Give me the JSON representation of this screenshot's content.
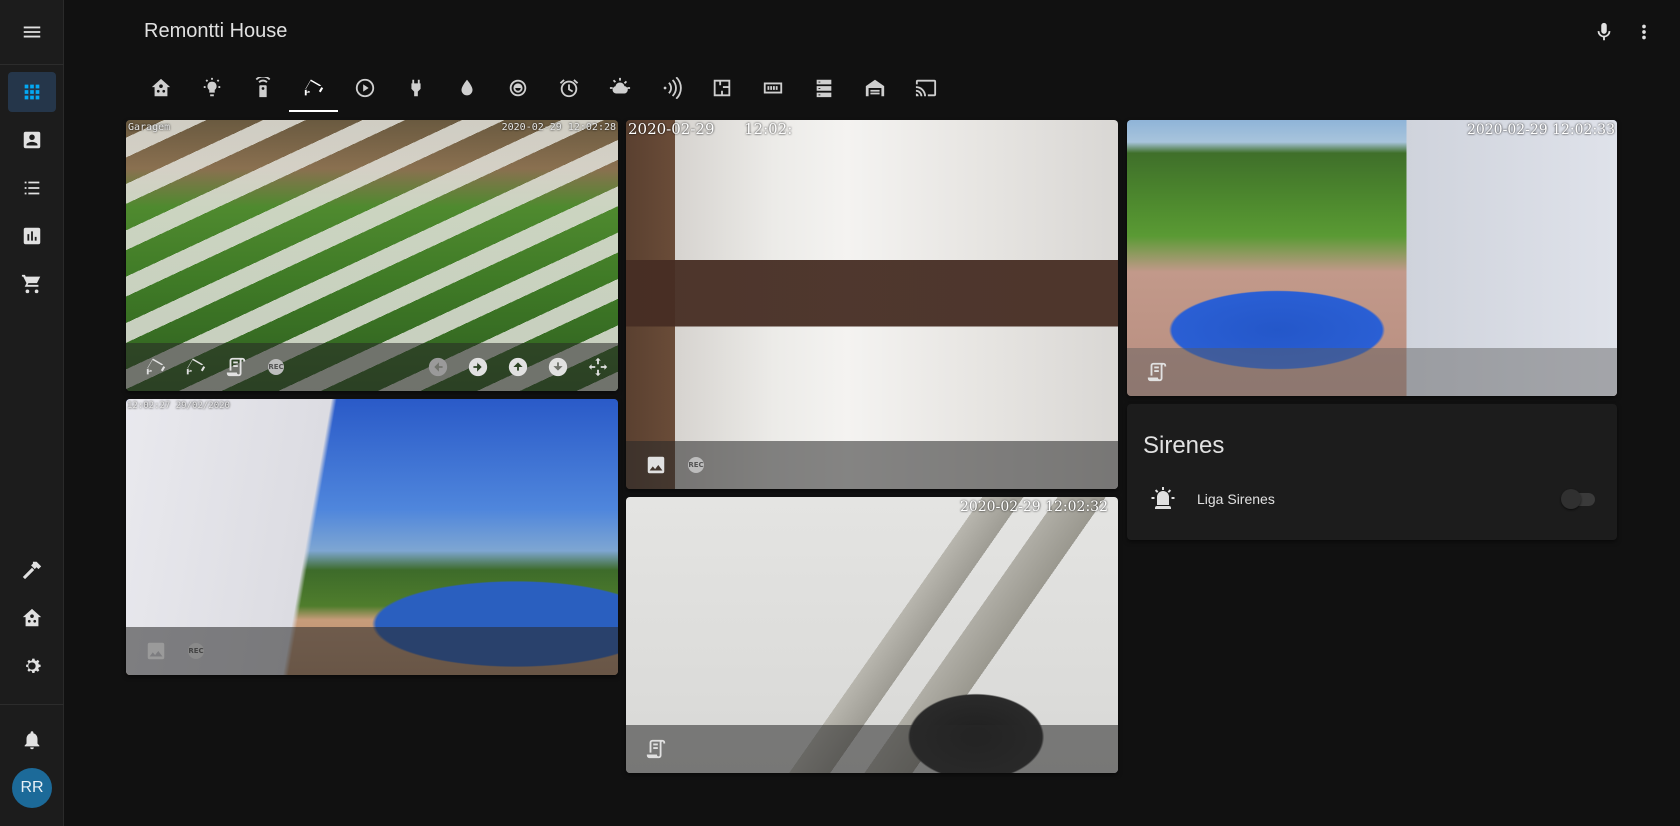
{
  "app": {
    "title": "Remontti House",
    "user_initials": "RR"
  },
  "header": {
    "menu_icon": "menu-icon",
    "mic_icon": "microphone-icon",
    "more_icon": "dots-vertical-icon"
  },
  "sidebar": {
    "items": [
      {
        "icon": "view-dashboard-icon",
        "active": true
      },
      {
        "icon": "account-box-icon",
        "active": false
      },
      {
        "icon": "format-list-bulleted-icon",
        "active": false
      },
      {
        "icon": "chart-box-icon",
        "active": false
      },
      {
        "icon": "cart-icon",
        "active": false
      }
    ],
    "bottom_items": [
      {
        "icon": "hammer-icon"
      },
      {
        "icon": "home-assistant-icon"
      },
      {
        "icon": "cog-icon"
      },
      {
        "icon": "bell-icon"
      }
    ],
    "active_color": "#03a9f4"
  },
  "tabs": [
    {
      "icon": "home-assistant-icon"
    },
    {
      "icon": "lightbulb-icon"
    },
    {
      "icon": "remote-icon"
    },
    {
      "icon": "cctv-icon",
      "active": true
    },
    {
      "icon": "play-circle-icon"
    },
    {
      "icon": "power-plug-icon"
    },
    {
      "icon": "water-icon"
    },
    {
      "icon": "washing-machine-icon"
    },
    {
      "icon": "alarm-icon"
    },
    {
      "icon": "weather-icon"
    },
    {
      "icon": "wifi-signal-icon"
    },
    {
      "icon": "floor-plan-icon"
    },
    {
      "icon": "router-icon"
    },
    {
      "icon": "server-icon"
    },
    {
      "icon": "garage-icon"
    },
    {
      "icon": "cast-icon"
    }
  ],
  "cameras": {
    "garagem": {
      "label": "Garagem",
      "timestamp": "2020-02-29 12:02:28"
    },
    "sala": {
      "timestamp": "2020-02-29",
      "timestamp_time": "12:02:"
    },
    "piscina": {
      "timestamp": "2020-02-29 12:02:33"
    },
    "fundos": {
      "timestamp": "12:02:27 29/02/2020"
    },
    "corredor": {
      "timestamp": "2020-02-29 12:02:32"
    }
  },
  "sirenes": {
    "title": "Sirenes",
    "entity_label": "Liga Sirenes",
    "entity_icon": "alarm-light-icon",
    "state": "off"
  }
}
